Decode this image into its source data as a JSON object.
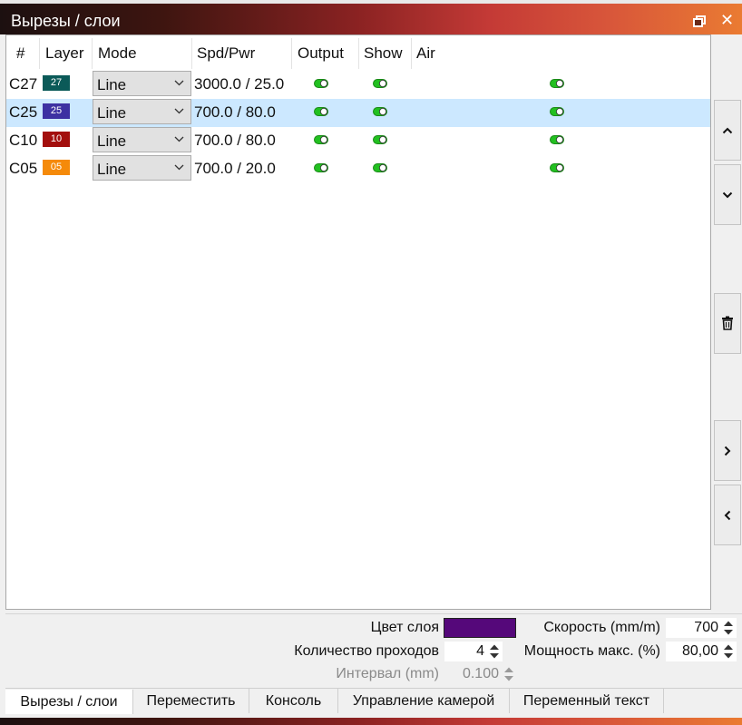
{
  "window": {
    "title": "Вырезы / слои"
  },
  "table": {
    "headers": [
      "#",
      "Layer",
      "Mode",
      "Spd/Pwr",
      "Output",
      "Show",
      "Air"
    ],
    "rows": [
      {
        "id": "C27",
        "layer": "27",
        "layer_color": "#0b5a58",
        "mode": "Line",
        "spdpwr": "3000.0 / 25.0",
        "selected": false
      },
      {
        "id": "C25",
        "layer": "25",
        "layer_color": "#3d31a2",
        "mode": "Line",
        "spdpwr": "700.0 / 80.0",
        "selected": true
      },
      {
        "id": "C10",
        "layer": "10",
        "layer_color": "#a30f0d",
        "mode": "Line",
        "spdpwr": "700.0 / 80.0",
        "selected": false
      },
      {
        "id": "C05",
        "layer": "05",
        "layer_color": "#f58a0a",
        "mode": "Line",
        "spdpwr": "700.0 / 20.0",
        "selected": false
      }
    ],
    "toggle_color": "#22c020"
  },
  "props": {
    "layer_color_label": "Цвет слоя",
    "layer_color": "#55087a",
    "passes_label": "Количество проходов",
    "passes": "4",
    "interval_label": "Интервал (mm)",
    "interval": "0.100",
    "speed_label": "Скорость (mm/m)",
    "speed": "700",
    "power_label": "Мощность макс. (%)",
    "power": "80,00"
  },
  "tabs": [
    {
      "label": "Вырезы / слои",
      "active": true
    },
    {
      "label": "Переместить",
      "active": false
    },
    {
      "label": "Консоль",
      "active": false
    },
    {
      "label": "Управление камерой",
      "active": false
    },
    {
      "label": "Переменный текст",
      "active": false
    }
  ]
}
